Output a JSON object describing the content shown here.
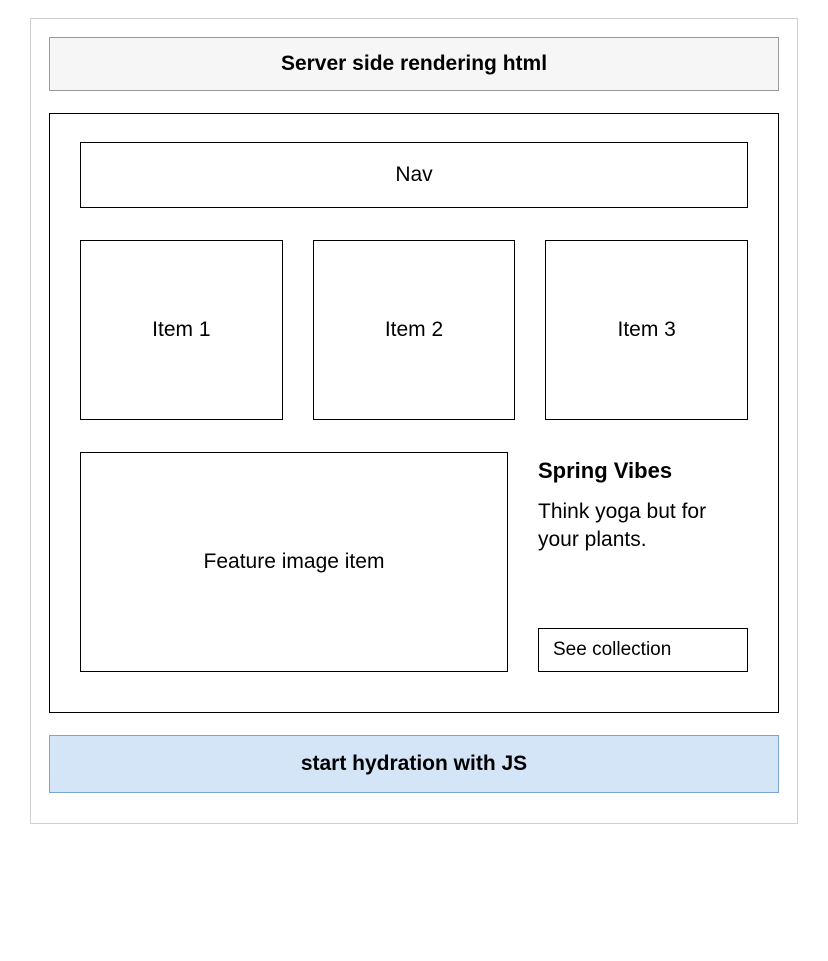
{
  "header": {
    "title": "Server side rendering html"
  },
  "page": {
    "nav_label": "Nav",
    "items": [
      {
        "label": "Item 1"
      },
      {
        "label": "Item 2"
      },
      {
        "label": "Item 3"
      }
    ],
    "feature": {
      "image_label": "Feature image item",
      "heading": "Spring Vibes",
      "subtext": "Think yoga but for your plants.",
      "cta_label": "See collection"
    }
  },
  "footer": {
    "title": "start hydration with JS"
  }
}
